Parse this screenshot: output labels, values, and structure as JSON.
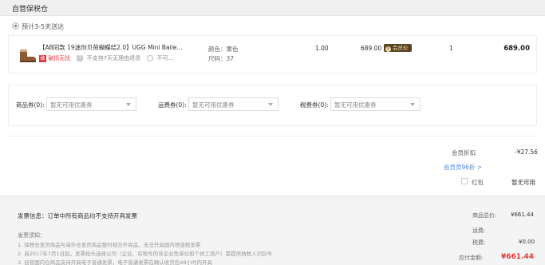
{
  "header": {
    "title": "自营保税仓"
  },
  "delivery": {
    "text": "预计3-5天送达"
  },
  "product": {
    "name": "【AB同款 19迷你贝荷蝴蝶结2.0】UGG Mini Baile...",
    "tag_badge": "破",
    "tag_main": "破损无忧",
    "tag_return": "不支持7天无理由退货",
    "tag_more": "不可...",
    "color_label": "颜色：栗色",
    "size_label": "尺码：37",
    "unit": "1.00",
    "price": "689.00",
    "vip_badge": "会员价",
    "qty": "1",
    "subtotal": "689.00"
  },
  "coupons": {
    "goods_label": "商品券(0):",
    "shipping_label": "运费券(0):",
    "tax_label": "税费券(0):",
    "placeholder": "暂无可用优惠券"
  },
  "totals": {
    "member_discount_label": "会员折扣",
    "member_discount_value": "-¥27.56",
    "vip_link": "会员员96折 >",
    "redpack_label": "红包",
    "redpack_value": "暂无可用"
  },
  "invoice": {
    "info": "发票信息：订单中所有商品均不支持开具发票",
    "notice_title": "发票须知：",
    "notes": [
      "1. 保税仓发货商品与海外仓发货商品暂时视为外商品，无法开具国内增值税发票",
      "2. 自2017年7月1日起，发票抬头选择公司（企业、有税号的非企业性单位和个体工商户）需提供纳税人识别号",
      "3. 自营国内仓商品支持开具电子普通发票，电子普通发票在确认收货后48小时内开具"
    ]
  },
  "summary": {
    "goods_label": "商品总价:",
    "goods_value": "¥661.44",
    "ship_label": "运费:",
    "tax_label": "税费:",
    "tax_value": "¥0.00",
    "pay_label": "应付金额:",
    "pay_value": "¥661.44"
  }
}
